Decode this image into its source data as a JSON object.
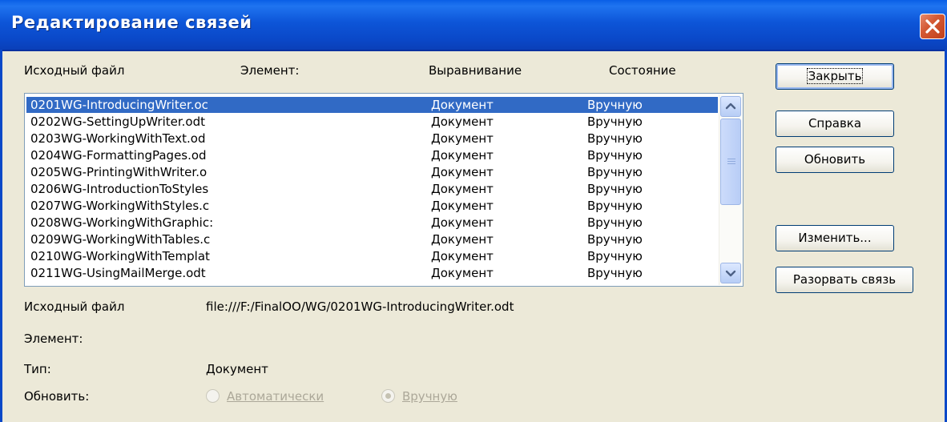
{
  "window": {
    "title": "Редактирование связей"
  },
  "columns": {
    "source": "Исходный файл",
    "element": "Элемент:",
    "alignment": "Выравнивание",
    "state": "Состояние"
  },
  "links": [
    {
      "file": "0201WG-IntroducingWriter.oc",
      "type": "Документ",
      "update": "Вручную",
      "selected": true
    },
    {
      "file": "0202WG-SettingUpWriter.odt",
      "type": "Документ",
      "update": "Вручную"
    },
    {
      "file": "0203WG-WorkingWithText.od",
      "type": "Документ",
      "update": "Вручную"
    },
    {
      "file": "0204WG-FormattingPages.od",
      "type": "Документ",
      "update": "Вручную"
    },
    {
      "file": "0205WG-PrintingWithWriter.o",
      "type": "Документ",
      "update": "Вручную"
    },
    {
      "file": "0206WG-IntroductionToStyles",
      "type": "Документ",
      "update": "Вручную"
    },
    {
      "file": "0207WG-WorkingWithStyles.c",
      "type": "Документ",
      "update": "Вручную"
    },
    {
      "file": "0208WG-WorkingWithGraphic:",
      "type": "Документ",
      "update": "Вручную"
    },
    {
      "file": "0209WG-WorkingWithTables.c",
      "type": "Документ",
      "update": "Вручную"
    },
    {
      "file": "0210WG-WorkingWithTemplat",
      "type": "Документ",
      "update": "Вручную"
    },
    {
      "file": "0211WG-UsingMailMerge.odt",
      "type": "Документ",
      "update": "Вручную"
    }
  ],
  "buttons": {
    "close": "Закрыть",
    "help": "Справка",
    "update": "Обновить",
    "modify": "Изменить...",
    "break_link": "Разорвать связь"
  },
  "details": {
    "source_label": "Исходный файл",
    "source_value": "file:///F:/FinalOO/WG/0201WG-IntroducingWriter.odt",
    "element_label": "Элемент:",
    "element_value": "",
    "type_label": "Тип:",
    "type_value": "Документ",
    "update_label": "Обновить:",
    "auto_option": "Автоматически",
    "manual_option": "Вручную",
    "selected_option": "manual"
  },
  "colors": {
    "titlebar": "#0a48c8",
    "selection": "#316ac5",
    "dialog_bg": "#ece9d8",
    "close_button": "#d45a34"
  }
}
